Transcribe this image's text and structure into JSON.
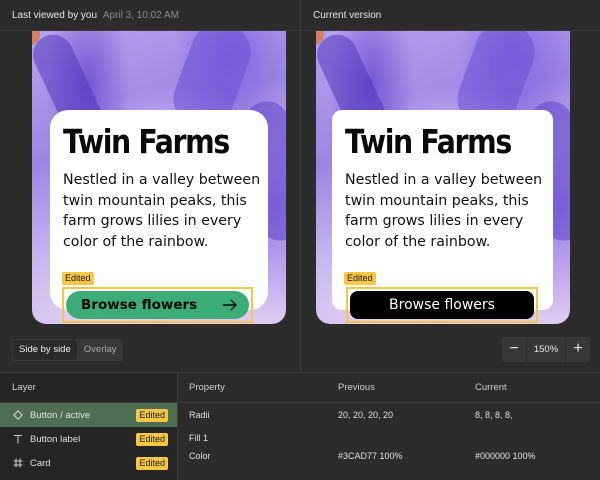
{
  "left_pane": {
    "header_title": "Last viewed by you",
    "header_timestamp": "April 3, 10:02 AM"
  },
  "right_pane": {
    "header_title": "Current version"
  },
  "card": {
    "title": "Twin Farms",
    "body": "Nestled in a valley between twin mountain peaks, this farm grows lilies in every color of the rainbow.",
    "button_label": "Browse flowers",
    "edited_tag": "Edited"
  },
  "view_toggle": {
    "options": [
      "Side by side",
      "Overlay"
    ],
    "selected": "Side by side"
  },
  "zoom": {
    "minus": "−",
    "value": "150%",
    "plus": "+"
  },
  "layers": {
    "header": "Layer",
    "items": [
      {
        "icon": "component-instance-icon",
        "label": "Button / active",
        "badge": "Edited",
        "selected": true
      },
      {
        "icon": "text-icon",
        "label": "Button label",
        "badge": "Edited",
        "selected": false
      },
      {
        "icon": "frame-icon",
        "label": "Card",
        "badge": "Edited",
        "selected": false
      }
    ]
  },
  "properties": {
    "headers": {
      "property": "Property",
      "previous": "Previous",
      "current": "Current"
    },
    "rows": [
      {
        "property": "Radii",
        "previous": "20, 20, 20, 20",
        "current": "8, 8, 8, 8,"
      },
      {
        "property": "Fill 1",
        "previous": "",
        "current": ""
      },
      {
        "property": "Color",
        "previous": "#3CAD77 100%",
        "current": "#000000 100%"
      }
    ]
  },
  "colors": {
    "previous_button": "#3CAD77",
    "current_button": "#000000",
    "edited_badge": "#F6C644",
    "selected_layer": "#4D6E52"
  }
}
